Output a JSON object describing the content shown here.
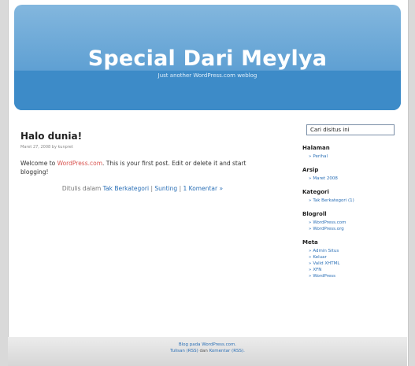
{
  "header": {
    "title": "Special Dari Meylya",
    "description": "Just another WordPress.com weblog"
  },
  "post": {
    "title": "Halo dunia!",
    "meta": "Maret 27, 2008 by kunpret",
    "body_prefix": "Welcome to ",
    "body_link": "WordPress.com",
    "body_suffix": ". This is your first post. Edit or delete it and start blogging!",
    "filed_label": "Ditulis dalam",
    "category_link": "Tak Berkategori",
    "sep1": "|",
    "edit_link": "Sunting",
    "sep2": "|",
    "comments_link": "1 Komentar »"
  },
  "search": {
    "value": "Cari disitus ini"
  },
  "sidebar": {
    "widgets": [
      {
        "title": "Halaman",
        "items": [
          "Perihal"
        ]
      },
      {
        "title": "Arsip",
        "items": [
          "Maret 2008"
        ]
      },
      {
        "title": "Kategori",
        "items": [
          "Tak Berkategori (1)"
        ]
      },
      {
        "title": "Blogroll",
        "items": [
          "WordPress.com",
          "WordPress.org"
        ]
      },
      {
        "title": "Meta",
        "items": [
          "Admin Situs",
          "Keluar",
          "Valid XHTML",
          "XFN",
          "WordPress"
        ]
      }
    ]
  },
  "footer": {
    "line1": "Blog pada WordPress.com.",
    "entries_rss": "Tulisan (RSS)",
    "and": "dan",
    "comments_rss": "Komentar (RSS)."
  },
  "colors": {
    "header_blue": "#3d8bc8",
    "link": "#2a6fb6"
  }
}
